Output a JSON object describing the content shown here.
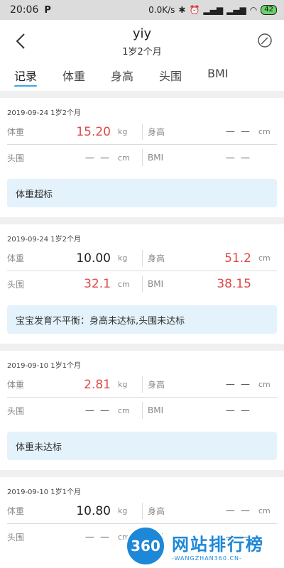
{
  "status_bar": {
    "time": "20:06",
    "carrier_icon": "P",
    "network_speed": "0.0K/s",
    "battery": "42"
  },
  "header": {
    "title": "yiy",
    "subtitle": "1岁2个月"
  },
  "tabs": [
    "记录",
    "体重",
    "身高",
    "头围",
    "BMI"
  ],
  "labels": {
    "weight": "体重",
    "height": "身高",
    "head": "头围",
    "bmi": "BMI",
    "unit_kg": "kg",
    "unit_cm": "cm",
    "dash": "— —"
  },
  "records": [
    {
      "date": "2019-09-24  1岁2个月",
      "weight": "15.20",
      "height": "— —",
      "head": "— —",
      "bmi": "— —",
      "note": "体重超标"
    },
    {
      "date": "2019-09-24  1岁2个月",
      "weight": "10.00",
      "height": "51.2",
      "head": "32.1",
      "bmi": "38.15",
      "note": "宝宝发育不平衡：身高未达标,头围未达标"
    },
    {
      "date": "2019-09-10  1岁1个月",
      "weight": "2.81",
      "height": "— —",
      "head": "— —",
      "bmi": "— —",
      "note": "体重未达标"
    },
    {
      "date": "2019-09-10  1岁1个月",
      "weight": "10.80",
      "height": "— —",
      "head": "— —",
      "bmi": "— —"
    }
  ],
  "watermark": {
    "logo": "360",
    "main": "网站排行榜",
    "sub": "-WANGZHAN360.CN-"
  },
  "colors": {
    "accent": "#3ea6e0",
    "alert": "#e04848",
    "note_bg": "#e3f2fb"
  }
}
